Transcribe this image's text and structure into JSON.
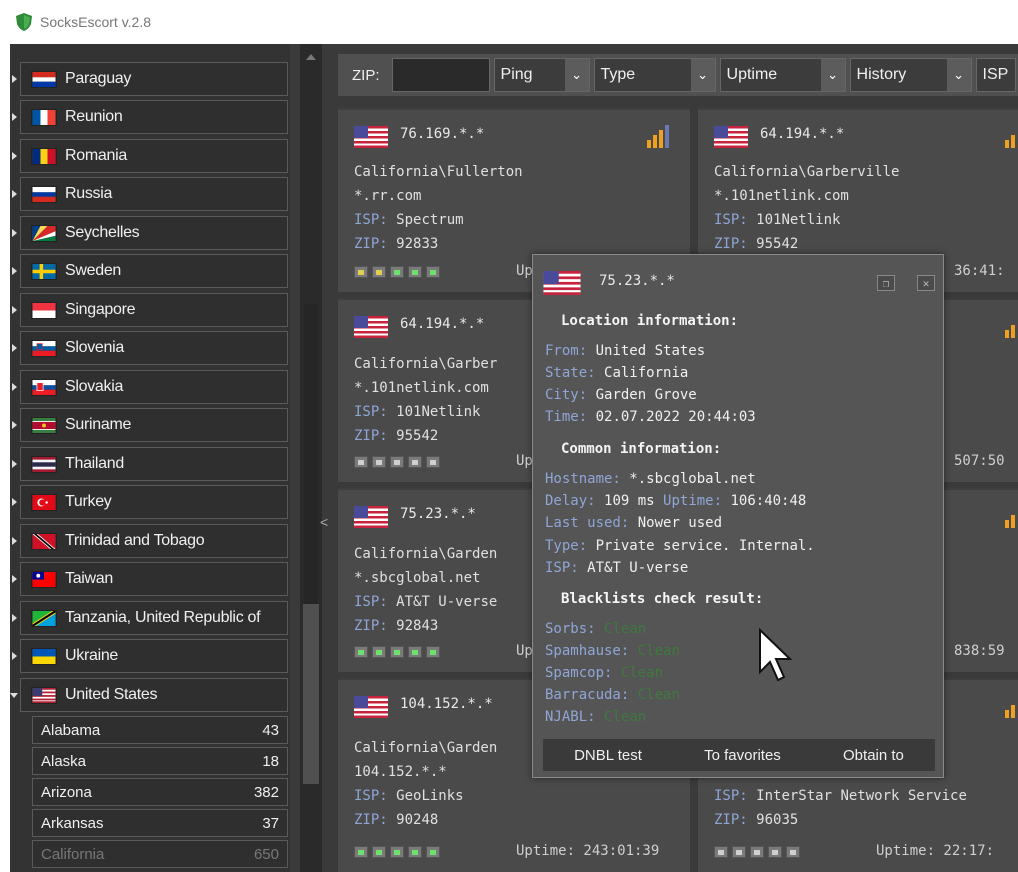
{
  "app": {
    "title": "SocksEscort v.2.8"
  },
  "sidebar": {
    "countries": [
      {
        "name": "Paraguay"
      },
      {
        "name": "Reunion"
      },
      {
        "name": "Romania"
      },
      {
        "name": "Russia"
      },
      {
        "name": "Seychelles"
      },
      {
        "name": "Sweden"
      },
      {
        "name": "Singapore"
      },
      {
        "name": "Slovenia"
      },
      {
        "name": "Slovakia"
      },
      {
        "name": "Suriname"
      },
      {
        "name": "Thailand"
      },
      {
        "name": "Turkey"
      },
      {
        "name": "Trinidad and Tobago"
      },
      {
        "name": "Taiwan"
      },
      {
        "name": "Tanzania, United Republic of"
      },
      {
        "name": "Ukraine"
      },
      {
        "name": "United States"
      }
    ],
    "states": [
      {
        "name": "Alabama",
        "count": "43"
      },
      {
        "name": "Alaska",
        "count": "18"
      },
      {
        "name": "Arizona",
        "count": "382"
      },
      {
        "name": "Arkansas",
        "count": "37"
      },
      {
        "name": "California",
        "count": "650"
      }
    ],
    "collapse_glyph": "<"
  },
  "filters": {
    "zip_label": "ZIP:",
    "zip_value": "",
    "ping": "Ping",
    "type": "Type",
    "uptime": "Uptime",
    "history": "History",
    "isp": "ISP"
  },
  "cards": [
    {
      "ip": "76.169.*.*",
      "location": "California\\Fullerton",
      "host": "*.rr.com",
      "isp_label": "ISP:",
      "isp": "Spectrum",
      "zip_label": "ZIP:",
      "zip": "92833",
      "uptime": "Up"
    },
    {
      "ip": "64.194.*.*",
      "location": "California\\Garberville",
      "host": "*.101netlink.com",
      "isp_label": "ISP:",
      "isp": "101Netlink",
      "zip_label": "ZIP:",
      "zip": "95542",
      "uptime": "36:41:"
    },
    {
      "ip": "64.194.*.*",
      "location": "California\\Garber",
      "host": "*.101netlink.com",
      "isp_label": "ISP:",
      "isp": "101Netlink",
      "zip_label": "ZIP:",
      "zip": "95542",
      "uptime": "Up"
    },
    {
      "uptime": "507:50"
    },
    {
      "ip": "75.23.*.*",
      "location": "California\\Garden",
      "host": "*.sbcglobal.net",
      "isp_label": "ISP:",
      "isp": "AT&T U-verse",
      "zip_label": "ZIP:",
      "zip": "92843",
      "uptime": "Up"
    },
    {
      "uptime": "838:59"
    },
    {
      "ip": "104.152.*.*",
      "location": "California\\Garden",
      "host": "104.152.*.*",
      "isp_label": "ISP:",
      "isp": "GeoLinks",
      "zip_label": "ZIP:",
      "zip": "90248",
      "uptime": "Uptime: 243:01:39"
    },
    {
      "isp_label": "ISP:",
      "isp": "InterStar Network Service",
      "zip_label": "ZIP:",
      "zip": "96035",
      "uptime": "Uptime: 22:17:"
    }
  ],
  "popup": {
    "ip": "75.23.*.*",
    "location_header": "Location information:",
    "from_label": "From:",
    "from": "United States",
    "state_label": "State:",
    "state": "California",
    "city_label": "City:",
    "city": "Garden Grove",
    "time_label": "Time:",
    "time": "02.07.2022 20:44:03",
    "common_header": "Common information:",
    "hostname_label": "Hostname:",
    "hostname": "*.sbcglobal.net",
    "delay_label": "Delay:",
    "delay": "109 ms",
    "uptime_label": "Uptime:",
    "uptime": "106:40:48",
    "last_used_label": "Last used:",
    "last_used": "Nower used",
    "type_label": "Type:",
    "type": "Private service. Internal.",
    "isp_label": "ISP:",
    "isp": "AT&T U-verse",
    "blacklist_header": "Blacklists check result:",
    "blacklists": [
      {
        "label": "Sorbs:",
        "status": "Clean"
      },
      {
        "label": "Spamhause:",
        "status": "Clean"
      },
      {
        "label": "Spamcop:",
        "status": "Clean"
      },
      {
        "label": "Barracuda:",
        "status": "Clean"
      },
      {
        "label": "NJABL:",
        "status": "Clean"
      }
    ],
    "buttons": {
      "dnbl": "DNBL test",
      "favorites": "To favorites",
      "obtain": "Obtain to"
    }
  },
  "colors": {
    "label_blue": "#8fa6d6",
    "clean_green": "#3f7a3f",
    "signal_orange": "#f0a020"
  }
}
